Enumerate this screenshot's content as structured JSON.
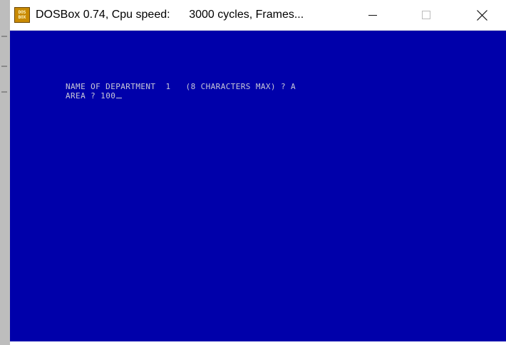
{
  "window": {
    "app_icon_text": "DOS BOX",
    "title": "DOSBox 0.74, Cpu speed:      3000 cycles, Frames..."
  },
  "controls": {
    "minimize": "minimize",
    "maximize": "maximize",
    "close": "close"
  },
  "console": {
    "line1": "NAME OF DEPARTMENT  1   (8 CHARACTERS MAX) ? A",
    "line2_prompt": "AREA ? ",
    "line2_value": "100"
  },
  "colors": {
    "screen_bg": "#0000aa",
    "text": "#c8c8d8"
  }
}
